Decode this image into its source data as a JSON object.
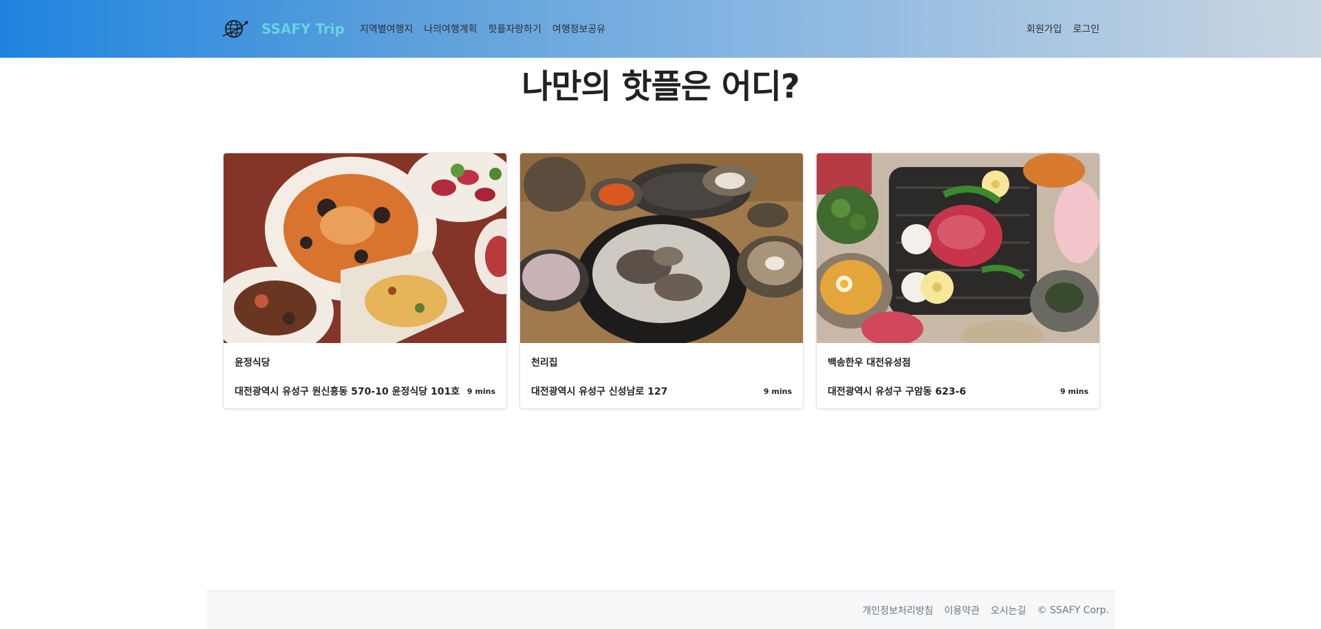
{
  "header": {
    "brand": "SSAFY Trip",
    "menu": [
      "지역별여행지",
      "나의여행계획",
      "핫플자랑하기",
      "여행정보공유"
    ],
    "auth": [
      "회원가입",
      "로그인"
    ]
  },
  "main": {
    "title": "나만의 핫플은 어디?",
    "cards": [
      {
        "name": "윤정식당",
        "address": "대전광역시 유성구 원신흥동 570-10 윤정식당 101호",
        "time": "9 mins"
      },
      {
        "name": "천리집",
        "address": "대전광역시 유성구 신성남로 127",
        "time": "9 mins"
      },
      {
        "name": "백송한우 대전유성점",
        "address": "대전광역시 유성구 구암동 623-6",
        "time": "9 mins"
      }
    ]
  },
  "footer": {
    "links": [
      "개인정보처리방침",
      "이용약관",
      "오시는길"
    ],
    "copyright": "© SSAFY Corp."
  },
  "colors": {
    "brand": "#67d3df",
    "nav_gradient_start": "#1f84df",
    "nav_gradient_end": "#c9d6e2"
  }
}
